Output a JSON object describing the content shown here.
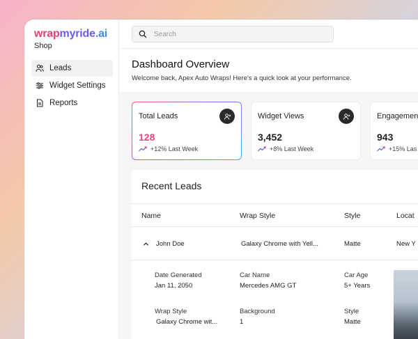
{
  "brand": {
    "part1": "wrap",
    "part2": "myride",
    "part3": ".ai",
    "subtitle": "Shop"
  },
  "sidebar": {
    "items": [
      {
        "label": "Leads",
        "icon": "users-icon"
      },
      {
        "label": "Widget Settings",
        "icon": "sliders-icon"
      },
      {
        "label": "Reports",
        "icon": "document-icon"
      }
    ]
  },
  "search": {
    "placeholder": "Search"
  },
  "header": {
    "title": "Dashboard Overview",
    "subtitle": "Welcome back, Apex Auto Wraps! Here's a quick look at your performance."
  },
  "cards": [
    {
      "title": "Total Leads",
      "value": "128",
      "trend": "+12% Last Week"
    },
    {
      "title": "Widget Views",
      "value": "3,452",
      "trend": "+8% Last Week"
    },
    {
      "title": "Engagemen",
      "value": "943",
      "trend": "+15% Las"
    }
  ],
  "leads": {
    "title": "Recent Leads",
    "columns": [
      "Name",
      "Wrap Style",
      "Style",
      "Locat"
    ],
    "row": {
      "name": "John Doe",
      "wrap_style": "Galaxy Chrome with Yell...",
      "style": "Matte",
      "location": "New Y"
    },
    "detail": {
      "date_label": "Date Generated",
      "date_value": "Jan 11, 2050",
      "car_label": "Car Name",
      "car_value": "Mercedes AMG GT",
      "age_label": "Car Age",
      "age_value": "5+ Years",
      "wrap_label": "Wrap Style",
      "wrap_value": "Galaxy Chrome wit...",
      "bg_label": "Background",
      "bg_value": "1",
      "style_label": "Style",
      "style_value": "Matte"
    }
  },
  "colors": {
    "brand_pink": "#e2427a",
    "brand_purple": "#6a5cf0",
    "brand_blue": "#3a8ee8",
    "trend": "#4a63d8"
  }
}
